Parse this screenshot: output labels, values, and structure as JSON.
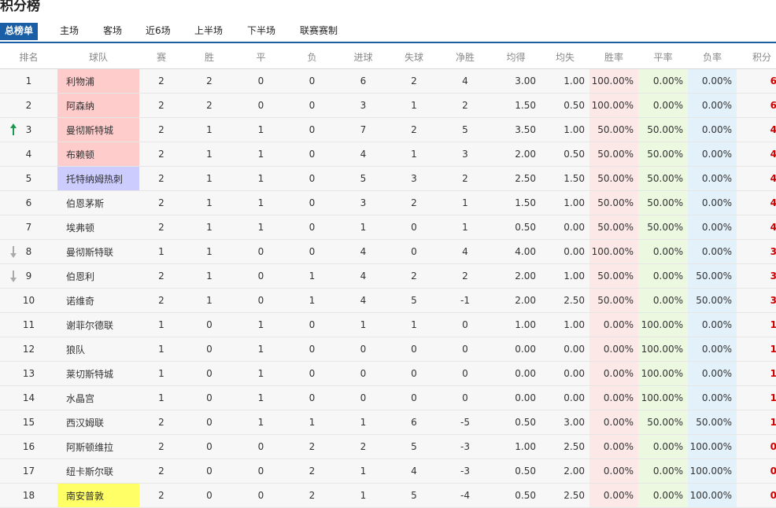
{
  "page_title": "积分榜",
  "tabs": [
    {
      "label": "总榜单",
      "active": true
    },
    {
      "label": "主场"
    },
    {
      "label": "客场"
    },
    {
      "label": "近6场"
    },
    {
      "label": "上半场"
    },
    {
      "label": "下半场"
    },
    {
      "label": "联赛赛制"
    }
  ],
  "columns": [
    "排名",
    "球队",
    "赛",
    "胜",
    "平",
    "负",
    "进球",
    "失球",
    "净胜",
    "均得",
    "均失",
    "胜率",
    "平率",
    "负率",
    "积分"
  ],
  "colors": {
    "tab_active": "#1a5fa6",
    "points": "#cc0000",
    "highlight_pink": "#ffcccc",
    "highlight_blue": "#ccccff",
    "highlight_yellow": "#ffff66",
    "arrow_up": "#1a9a50",
    "arrow_down": "#aaaaaa"
  },
  "rows": [
    {
      "rank": "1",
      "team": "利物浦",
      "played": "2",
      "won": "2",
      "drawn": "0",
      "lost": "0",
      "gf": "6",
      "ga": "2",
      "gd": "4",
      "avg_for": "3.00",
      "avg_against": "1.00",
      "win_rate": "100.00%",
      "draw_rate": "0.00%",
      "loss_rate": "0.00%",
      "points": "6",
      "highlight": "pink"
    },
    {
      "rank": "2",
      "team": "阿森纳",
      "played": "2",
      "won": "2",
      "drawn": "0",
      "lost": "0",
      "gf": "3",
      "ga": "1",
      "gd": "2",
      "avg_for": "1.50",
      "avg_against": "0.50",
      "win_rate": "100.00%",
      "draw_rate": "0.00%",
      "loss_rate": "0.00%",
      "points": "6",
      "highlight": "pink"
    },
    {
      "rank": "3",
      "team": "曼彻斯特城",
      "played": "2",
      "won": "1",
      "drawn": "1",
      "lost": "0",
      "gf": "7",
      "ga": "2",
      "gd": "5",
      "avg_for": "3.50",
      "avg_against": "1.00",
      "win_rate": "50.00%",
      "draw_rate": "50.00%",
      "loss_rate": "0.00%",
      "points": "4",
      "highlight": "pink",
      "trend": "up"
    },
    {
      "rank": "4",
      "team": "布赖顿",
      "played": "2",
      "won": "1",
      "drawn": "1",
      "lost": "0",
      "gf": "4",
      "ga": "1",
      "gd": "3",
      "avg_for": "2.00",
      "avg_against": "0.50",
      "win_rate": "50.00%",
      "draw_rate": "50.00%",
      "loss_rate": "0.00%",
      "points": "4",
      "highlight": "pink"
    },
    {
      "rank": "5",
      "team": "托特纳姆热刺",
      "played": "2",
      "won": "1",
      "drawn": "1",
      "lost": "0",
      "gf": "5",
      "ga": "3",
      "gd": "2",
      "avg_for": "2.50",
      "avg_against": "1.50",
      "win_rate": "50.00%",
      "draw_rate": "50.00%",
      "loss_rate": "0.00%",
      "points": "4",
      "highlight": "blue"
    },
    {
      "rank": "6",
      "team": "伯恩茅斯",
      "played": "2",
      "won": "1",
      "drawn": "1",
      "lost": "0",
      "gf": "3",
      "ga": "2",
      "gd": "1",
      "avg_for": "1.50",
      "avg_against": "1.00",
      "win_rate": "50.00%",
      "draw_rate": "50.00%",
      "loss_rate": "0.00%",
      "points": "4"
    },
    {
      "rank": "7",
      "team": "埃弗顿",
      "played": "2",
      "won": "1",
      "drawn": "1",
      "lost": "0",
      "gf": "1",
      "ga": "0",
      "gd": "1",
      "avg_for": "0.50",
      "avg_against": "0.00",
      "win_rate": "50.00%",
      "draw_rate": "50.00%",
      "loss_rate": "0.00%",
      "points": "4"
    },
    {
      "rank": "8",
      "team": "曼彻斯特联",
      "played": "1",
      "won": "1",
      "drawn": "0",
      "lost": "0",
      "gf": "4",
      "ga": "0",
      "gd": "4",
      "avg_for": "4.00",
      "avg_against": "0.00",
      "win_rate": "100.00%",
      "draw_rate": "0.00%",
      "loss_rate": "0.00%",
      "points": "3",
      "trend": "down"
    },
    {
      "rank": "9",
      "team": "伯恩利",
      "played": "2",
      "won": "1",
      "drawn": "0",
      "lost": "1",
      "gf": "4",
      "ga": "2",
      "gd": "2",
      "avg_for": "2.00",
      "avg_against": "1.00",
      "win_rate": "50.00%",
      "draw_rate": "0.00%",
      "loss_rate": "50.00%",
      "points": "3",
      "trend": "down"
    },
    {
      "rank": "10",
      "team": "诺维奇",
      "played": "2",
      "won": "1",
      "drawn": "0",
      "lost": "1",
      "gf": "4",
      "ga": "5",
      "gd": "-1",
      "avg_for": "2.00",
      "avg_against": "2.50",
      "win_rate": "50.00%",
      "draw_rate": "0.00%",
      "loss_rate": "50.00%",
      "points": "3"
    },
    {
      "rank": "11",
      "team": "谢菲尔德联",
      "played": "1",
      "won": "0",
      "drawn": "1",
      "lost": "0",
      "gf": "1",
      "ga": "1",
      "gd": "0",
      "avg_for": "1.00",
      "avg_against": "1.00",
      "win_rate": "0.00%",
      "draw_rate": "100.00%",
      "loss_rate": "0.00%",
      "points": "1"
    },
    {
      "rank": "12",
      "team": "狼队",
      "played": "1",
      "won": "0",
      "drawn": "1",
      "lost": "0",
      "gf": "0",
      "ga": "0",
      "gd": "0",
      "avg_for": "0.00",
      "avg_against": "0.00",
      "win_rate": "0.00%",
      "draw_rate": "100.00%",
      "loss_rate": "0.00%",
      "points": "1"
    },
    {
      "rank": "13",
      "team": "莱切斯特城",
      "played": "1",
      "won": "0",
      "drawn": "1",
      "lost": "0",
      "gf": "0",
      "ga": "0",
      "gd": "0",
      "avg_for": "0.00",
      "avg_against": "0.00",
      "win_rate": "0.00%",
      "draw_rate": "100.00%",
      "loss_rate": "0.00%",
      "points": "1"
    },
    {
      "rank": "14",
      "team": "水晶宫",
      "played": "1",
      "won": "0",
      "drawn": "1",
      "lost": "0",
      "gf": "0",
      "ga": "0",
      "gd": "0",
      "avg_for": "0.00",
      "avg_against": "0.00",
      "win_rate": "0.00%",
      "draw_rate": "100.00%",
      "loss_rate": "0.00%",
      "points": "1"
    },
    {
      "rank": "15",
      "team": "西汉姆联",
      "played": "2",
      "won": "0",
      "drawn": "1",
      "lost": "1",
      "gf": "1",
      "ga": "6",
      "gd": "-5",
      "avg_for": "0.50",
      "avg_against": "3.00",
      "win_rate": "0.00%",
      "draw_rate": "50.00%",
      "loss_rate": "50.00%",
      "points": "1"
    },
    {
      "rank": "16",
      "team": "阿斯顿维拉",
      "played": "2",
      "won": "0",
      "drawn": "0",
      "lost": "2",
      "gf": "2",
      "ga": "5",
      "gd": "-3",
      "avg_for": "1.00",
      "avg_against": "2.50",
      "win_rate": "0.00%",
      "draw_rate": "0.00%",
      "loss_rate": "100.00%",
      "points": "0"
    },
    {
      "rank": "17",
      "team": "纽卡斯尔联",
      "played": "2",
      "won": "0",
      "drawn": "0",
      "lost": "2",
      "gf": "1",
      "ga": "4",
      "gd": "-3",
      "avg_for": "0.50",
      "avg_against": "2.00",
      "win_rate": "0.00%",
      "draw_rate": "0.00%",
      "loss_rate": "100.00%",
      "points": "0"
    },
    {
      "rank": "18",
      "team": "南安普敦",
      "played": "2",
      "won": "0",
      "drawn": "0",
      "lost": "2",
      "gf": "1",
      "ga": "5",
      "gd": "-4",
      "avg_for": "0.50",
      "avg_against": "2.50",
      "win_rate": "0.00%",
      "draw_rate": "0.00%",
      "loss_rate": "100.00%",
      "points": "0",
      "highlight": "yellow"
    }
  ]
}
